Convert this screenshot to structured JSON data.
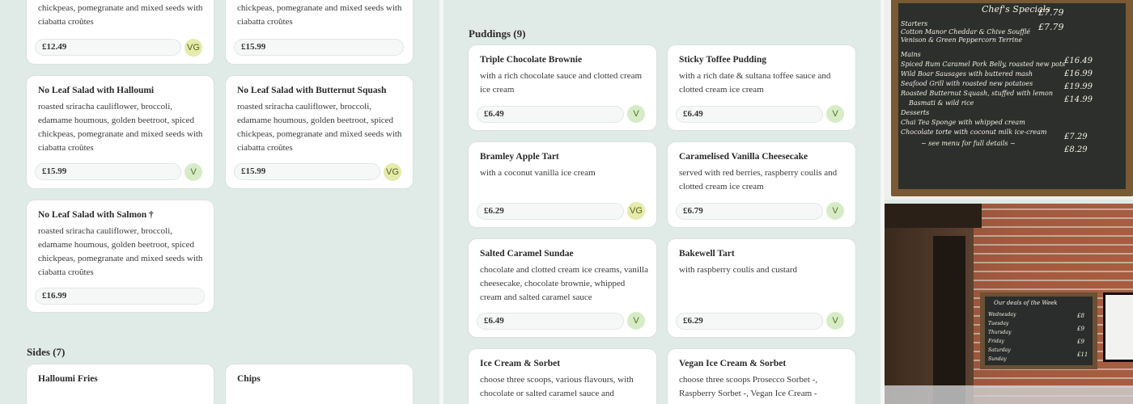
{
  "mains_left": {
    "cards": [
      {
        "desc": "chickpeas, pomegranate and mixed seeds with ciabatta croûtes",
        "price": "£12.49",
        "badge": "VG"
      },
      {
        "desc": "chickpeas, pomegranate and mixed seeds with ciabatta croûtes",
        "price": "£15.99",
        "badge": ""
      },
      {
        "title": "No Leaf Salad with Halloumi",
        "desc": "roasted sriracha cauliflower, broccoli, edamame houmous, golden beetroot, spiced chickpeas, pomegranate and mixed seeds with ciabatta croûtes",
        "price": "£15.99",
        "badge": "V"
      },
      {
        "title": "No Leaf Salad with Butternut Squash",
        "desc": "roasted sriracha cauliflower, broccoli, edamame houmous, golden beetroot, spiced chickpeas, pomegranate and mixed seeds with ciabatta croûtes",
        "price": "£15.99",
        "badge": "VG"
      },
      {
        "title": "No Leaf Salad with Salmon †",
        "desc": "roasted sriracha cauliflower, broccoli, edamame houmous, golden beetroot, spiced chickpeas, pomegranate and mixed seeds with ciabatta croûtes",
        "price": "£16.99",
        "badge": ""
      }
    ]
  },
  "sides": {
    "heading": "Sides (7)",
    "cards": [
      {
        "title": "Halloumi Fries"
      },
      {
        "title": "Chips"
      }
    ]
  },
  "puddings": {
    "heading": "Puddings (9)",
    "cards": [
      {
        "title": "Triple Chocolate Brownie",
        "desc": "with a rich chocolate sauce and clotted cream ice cream",
        "price": "£6.49",
        "badge": "V"
      },
      {
        "title": "Sticky Toffee Pudding",
        "desc": "with a rich date & sultana toffee sauce and clotted cream ice cream",
        "price": "£6.49",
        "badge": "V"
      },
      {
        "title": "Bramley Apple Tart",
        "desc": "with a coconut vanilla ice cream",
        "price": "£6.29",
        "badge": "VG"
      },
      {
        "title": "Caramelised Vanilla Cheesecake",
        "desc": "served with red berries, raspberry coulis and clotted cream ice cream",
        "price": "£6.79",
        "badge": "V"
      },
      {
        "title": "Salted Caramel Sundae",
        "desc": "chocolate and clotted cream ice creams, vanilla cheesecake, chocolate brownie, whipped cream and salted caramel sauce",
        "price": "£6.49",
        "badge": "V"
      },
      {
        "title": "Bakewell Tart",
        "desc": "with raspberry coulis and custard",
        "price": "£6.29",
        "badge": "V"
      },
      {
        "title": "Ice Cream & Sorbet",
        "desc": "choose three scoops, various flavours, with chocolate or salted caramel sauce and"
      },
      {
        "title": "Vegan Ice Cream & Sorbet",
        "desc": "choose three scoops Prosecco Sorbet -, Raspberry Sorbet -, Vegan Ice Cream -"
      }
    ]
  },
  "photos": {
    "board_text": {
      "heading": "Chef's Specials",
      "lines": [
        "Starters",
        "Cotton Manor Cheddar & Chive Soufflé",
        "Venison & Green Peppercorn Terrine",
        "Mains",
        "Spiced Rum Caramel Pork Belly, roasted new pots",
        "Wild Boar Sausages with buttered mash",
        "Seafood Grill with roasted new potatoes",
        "Roasted Butternut Squash, stuffed with lemon",
        "Basmati & wild rice",
        "Desserts",
        "Chai Tea Sponge with whipped cream",
        "Chocolate torte with coconut milk ice-cream",
        "~ see menu for full details ~"
      ],
      "prices": [
        "£7.79",
        "£7.79",
        "£16.49",
        "£16.99",
        "£19.99",
        "£14.99",
        "£7.29",
        "£8.29"
      ]
    },
    "pub_board": {
      "heading": "Our deals of the Week",
      "lines": [
        "Wednesday",
        "Tuesday",
        "Thursday",
        "Friday",
        "Saturday",
        "Sunday"
      ],
      "prices": [
        "£8",
        "£9",
        "£9",
        "£11"
      ]
    }
  },
  "colors": {
    "badge_v": "#d6ecc6",
    "badge_vg": "#e4ebab",
    "background": "#e0eae7"
  }
}
